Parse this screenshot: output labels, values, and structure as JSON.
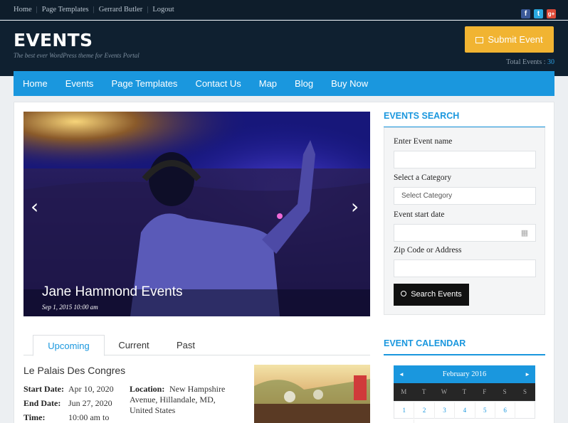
{
  "topbar": {
    "links": [
      "Home",
      "Page Templates",
      "Gerrard Butler",
      "Logout"
    ],
    "social": [
      {
        "icon": "facebook-icon",
        "glyph": "f",
        "color": "#3b5998"
      },
      {
        "icon": "twitter-icon",
        "glyph": "t",
        "color": "#2aa9e0"
      },
      {
        "icon": "google-plus-icon",
        "glyph": "g+",
        "color": "#dd4b39"
      }
    ]
  },
  "header": {
    "title": "EVENTS",
    "tagline": "The best ever WordPress theme for Events Portal",
    "submit_label": "Submit Event",
    "total_label": "Total Events :",
    "total_value": "30"
  },
  "nav": {
    "items": [
      "Home",
      "Events",
      "Page Templates",
      "Contact Us",
      "Map",
      "Blog",
      "Buy Now"
    ]
  },
  "slider": {
    "title": "Jane Hammond Events",
    "date": "Sep 1, 2015 10:00 am",
    "prev": "‹",
    "next": "›"
  },
  "tabs": [
    "Upcoming",
    "Current",
    "Past"
  ],
  "event": {
    "title": "Le Palais Des Congres",
    "start_label": "Start Date:",
    "start": "Apr 10, 2020",
    "end_label": "End Date:",
    "end": "Jun 27, 2020",
    "time_label": "Time:",
    "time": "10:00 am to",
    "location_label": "Location:",
    "location_l1": "New Hampshire",
    "location_l2": "Avenue, Hillandale, MD,",
    "location_l3": "United States"
  },
  "search": {
    "title": "EVENTS SEARCH",
    "name_label": "Enter Event name",
    "category_label": "Select a Category",
    "category_value": "Select Category",
    "date_label": "Event start date",
    "zip_label": "Zip Code or Address",
    "button": "Search Events"
  },
  "calendar": {
    "title": "EVENT CALENDAR",
    "month": "February 2016",
    "prev": "◄",
    "next": "►",
    "days": [
      "M",
      "T",
      "W",
      "T",
      "F",
      "S",
      "S"
    ],
    "dates": [
      "1",
      "2",
      "3",
      "4",
      "5",
      "6",
      "7"
    ]
  },
  "colors": {
    "accent": "#1a97de",
    "submit": "#f1b432",
    "header": "#0f2030"
  }
}
